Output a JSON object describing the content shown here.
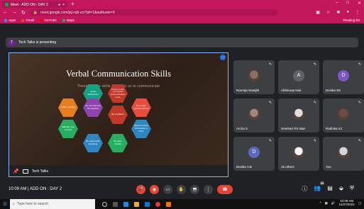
{
  "browser": {
    "tab_title": "Meet - ADD ON : DAY 2",
    "url": "meet.google.com/jxj-rvjb-vcr?pli=1&authuser=0",
    "bookmarks": [
      "Apps",
      "Gmail",
      "YouTube",
      "Maps"
    ],
    "reading_list": "Reading list"
  },
  "banner": {
    "avatar_letter": "T",
    "text": "Tech Talks is presenting"
  },
  "presentation": {
    "title": "Verbal Communication Skills",
    "subtitle": "These are the skills that help us to communicate",
    "presenter": "Tech Talks",
    "hexagons": [
      {
        "text": "Avoid distractions",
        "color": "#16a085"
      },
      {
        "text": "Focus on the non-verbal communication cues",
        "color": "#c0392b"
      },
      {
        "text": "Listen carefully",
        "color": "#e67e22"
      },
      {
        "text": "Do not interrupt the speaker",
        "color": "#8e44ad"
      },
      {
        "text": "Be a calm speaker person",
        "color": "#e74c3c"
      },
      {
        "text": "Be confident",
        "color": "#c0392b"
      },
      {
        "text": "Maintain eye contact",
        "color": "#27ae60"
      },
      {
        "text": "Represent the information in short",
        "color": "#2e86c1"
      },
      {
        "text": "Be quiet while speaking",
        "color": "#2e86c1"
      },
      {
        "text": "Be quiet minded",
        "color": "#27ae60"
      }
    ]
  },
  "tiles": [
    {
      "name": "Neeraja Sreejith",
      "letter": "",
      "color": "#3c4043"
    },
    {
      "name": "Abhinoop Nair",
      "letter": "A",
      "color": "#5f6368"
    },
    {
      "name": "Devika SS",
      "letter": "D",
      "color": "#7e57c2"
    },
    {
      "name": "Archa S",
      "letter": "",
      "color": "#3c4043"
    },
    {
      "name": "Sreehari RS Nair",
      "letter": "",
      "color": "#3c4043"
    },
    {
      "name": "Radhika SJ",
      "letter": "",
      "color": "#3c4043"
    },
    {
      "name": "Devika V.B",
      "letter": "D",
      "color": "#5c6bc0"
    },
    {
      "name": "19 others",
      "letter": "",
      "color": "#3c4043"
    },
    {
      "name": "You",
      "letter": "",
      "color": "#3c4043"
    }
  ],
  "meeting": {
    "time": "10:09 AM",
    "separator": "|",
    "name": "ADD ON : DAY 2",
    "participants_badge": "29"
  },
  "taskbar": {
    "search_placeholder": "Type here to search",
    "time": "10:09 AM",
    "date": "11/27/2021"
  },
  "colors": {
    "chrome": "#c2185b",
    "meet_bg": "#202124",
    "end_call": "#ea4335"
  }
}
